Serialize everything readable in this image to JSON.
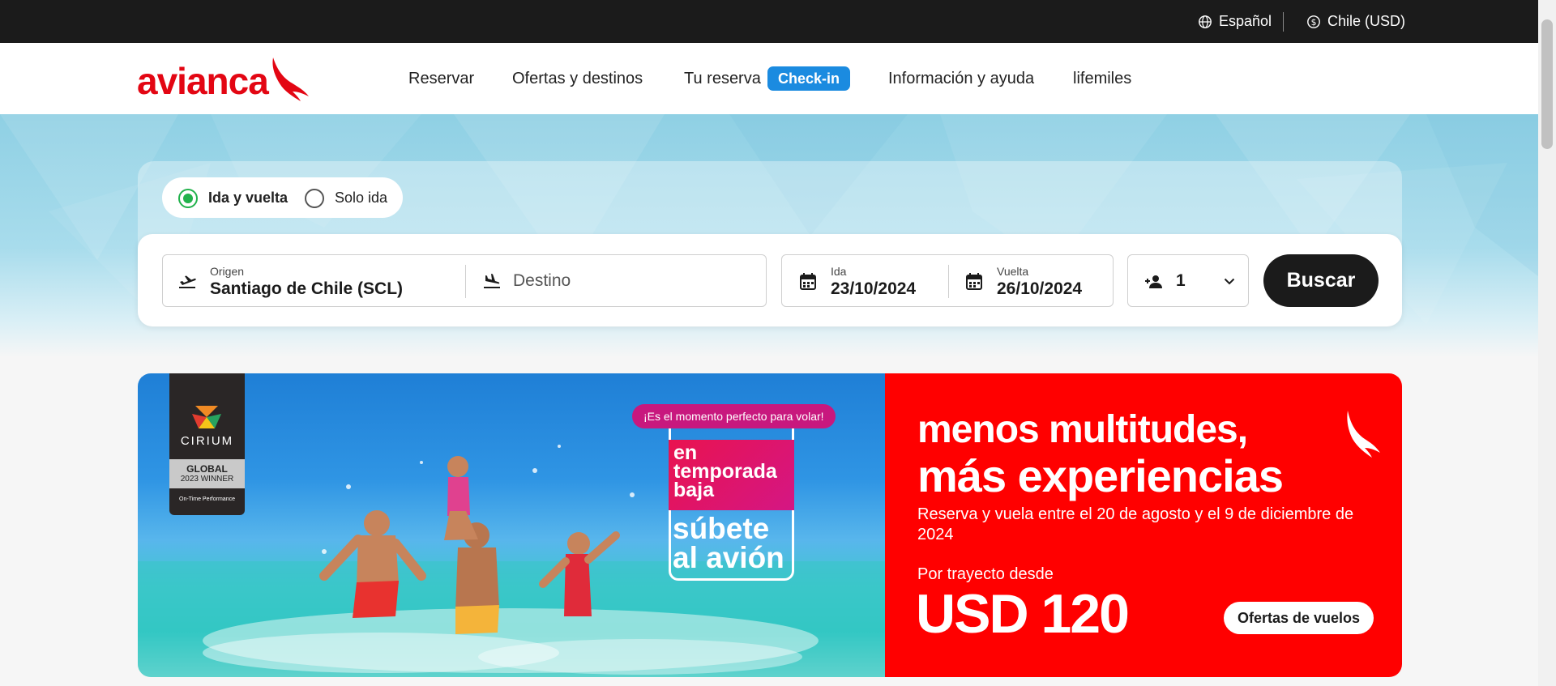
{
  "topbar": {
    "language_label": "Español",
    "country_label": "Chile (USD)"
  },
  "header": {
    "logo_text": "avianca",
    "nav": [
      {
        "label": "Reservar"
      },
      {
        "label": "Ofertas y destinos"
      },
      {
        "label": "Tu reserva"
      },
      {
        "label": "Información y ayuda"
      },
      {
        "label": "lifemiles"
      }
    ],
    "checkin_badge": "Check-in"
  },
  "search": {
    "trip_types": [
      {
        "label": "Ida y vuelta",
        "selected": true
      },
      {
        "label": "Solo ida",
        "selected": false
      }
    ],
    "origin": {
      "label": "Origen",
      "value": "Santiago de Chile  (SCL)"
    },
    "destination": {
      "placeholder": "Destino"
    },
    "depart": {
      "label": "Ida",
      "value": "23/10/2024"
    },
    "return": {
      "label": "Vuelta",
      "value": "26/10/2024"
    },
    "passengers": {
      "value": "1"
    },
    "search_button": "Buscar"
  },
  "banner": {
    "cirium": {
      "name": "CIRIUM",
      "award": "GLOBAL",
      "winner": "2023 WINNER",
      "category": "On-Time Performance"
    },
    "pill_text": "¡Es el momento perfecto para volar!",
    "promo_lines": [
      "en",
      "temporada",
      "baja"
    ],
    "promo_sub": [
      "súbete",
      "al avión"
    ],
    "headline_1": "menos multitudes,",
    "headline_2": "más experiencias",
    "description": "Reserva y vuela entre el 20 de agosto y el 9 de diciembre de 2024",
    "price_prefix": "Por trayecto desde",
    "price": "USD 120",
    "cta_label": "Ofertas de vuelos"
  },
  "colors": {
    "brand_red": "#e30613",
    "banner_red": "#ff0000",
    "checkin_blue": "#1b8be0",
    "radio_green": "#22b24c",
    "dark": "#1b1b1b"
  }
}
